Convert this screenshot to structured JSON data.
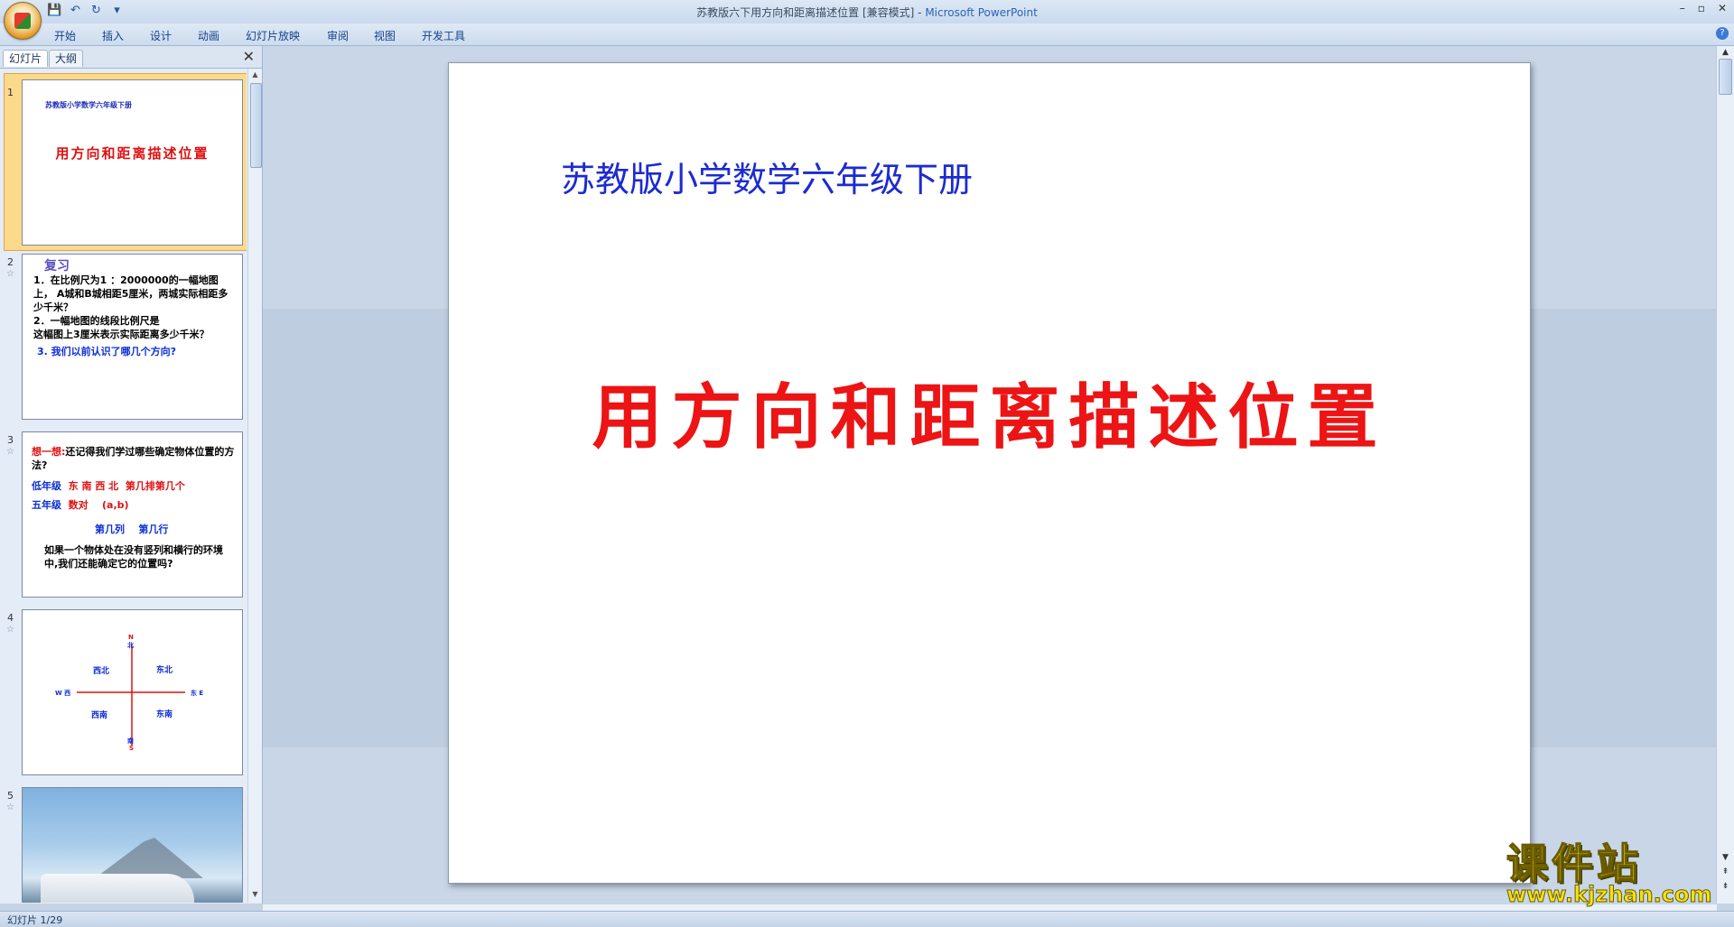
{
  "window": {
    "title": "苏教版六下用方向和距离描述位置 [兼容模式]",
    "app_name": "Microsoft PowerPoint",
    "separator": " - ",
    "controls": [
      "–",
      "▫",
      "✕"
    ]
  },
  "ribbon": {
    "tabs": [
      "开始",
      "插入",
      "设计",
      "动画",
      "幻灯片放映",
      "审阅",
      "视图",
      "开发工具"
    ],
    "help": "?"
  },
  "panel": {
    "tabs": [
      "幻灯片",
      "大纲"
    ],
    "close": "✕"
  },
  "thumbnails": [
    {
      "num": "1",
      "subtitle": "苏教版小学数学六年级下册",
      "title": "用方向和距离描述位置"
    },
    {
      "num": "2",
      "heading": "复习",
      "q1": "1．在比例尺为1 ：2000000的一幅地图上， A城和B城相距5厘米，两城实际相距多少千米？",
      "q2": "2．一幅地图的线段比例尺是",
      "q2_tail": "这幅图上3厘米表示实际距离多少千米？",
      "q3": "3. 我们以前认识了哪几个方向?"
    },
    {
      "num": "3",
      "prompt_red": "想一想:",
      "prompt": "还记得我们学过哪些确定物体位置的方法?",
      "row1_label": "低年级",
      "row1_dirs": "东 南 西 北",
      "row1_extra": "第几排第几个",
      "row2_label": "五年级",
      "row2_a": "数对",
      "row2_b": "(a,b)",
      "col": "第几列",
      "row": "第几行",
      "question": "如果一个物体处在没有竖列和横行的环境中,我们还能确定它的位置吗?"
    },
    {
      "num": "4",
      "nw": "西北",
      "ne": "东北",
      "sw": "西南",
      "se": "东南",
      "n": "北",
      "n_letter": "N",
      "s": "南",
      "s_letter": "S",
      "w": "W 西",
      "e": "东 E"
    },
    {
      "num": "5"
    }
  ],
  "slide": {
    "subtitle": "苏教版小学数学六年级下册",
    "title": "用方向和距离描述位置"
  },
  "status": {
    "text": "幻灯片 1/29"
  },
  "watermark": {
    "name": "课件站",
    "url": "www.kjzhan.com"
  }
}
